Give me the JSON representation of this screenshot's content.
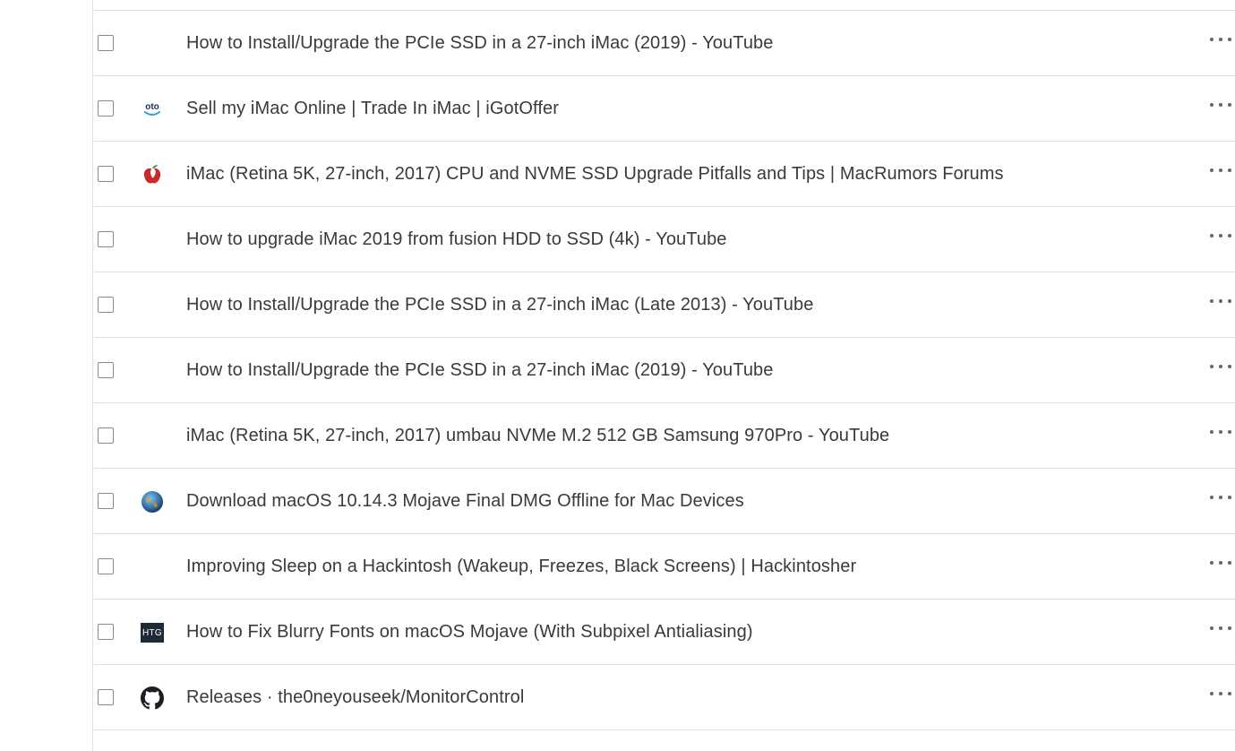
{
  "bookmarks": [
    {
      "title": "How to Install/Upgrade the PCIe SSD in a 27-inch iMac (2019) - YouTube",
      "icon": "none"
    },
    {
      "title": "Sell my iMac Online | Trade In iMac | iGotOffer",
      "icon": "igotoffer-icon"
    },
    {
      "title": "iMac (Retina 5K, 27-inch, 2017) CPU and NVME SSD Upgrade Pitfalls and Tips | MacRumors Forums",
      "icon": "macrumors-apple-icon"
    },
    {
      "title": "How to upgrade iMac 2019 from fusion HDD to SSD (4k) - YouTube",
      "icon": "none"
    },
    {
      "title": "How to Install/Upgrade the PCIe SSD in a 27-inch iMac (Late 2013) - YouTube",
      "icon": "none"
    },
    {
      "title": "How to Install/Upgrade the PCIe SSD in a 27-inch iMac (2019) - YouTube",
      "icon": "none"
    },
    {
      "title": "iMac (Retina 5K, 27-inch, 2017) umbau NVMe M.2 512 GB Samsung 970Pro - YouTube",
      "icon": "none"
    },
    {
      "title": "Download macOS 10.14.3 Mojave Final DMG Offline for Mac Devices",
      "icon": "mojave-globe-icon"
    },
    {
      "title": "Improving Sleep on a Hackintosh (Wakeup, Freezes, Black Screens) | Hackintosher",
      "icon": "none"
    },
    {
      "title": "How to Fix Blurry Fonts on macOS Mojave (With Subpixel Antialiasing)",
      "icon": "htg-icon"
    },
    {
      "title": "Releases · the0neyouseek/MonitorControl",
      "icon": "github-icon"
    }
  ],
  "icons": {
    "igotoffer_text": "oto",
    "htg_text": "HTG"
  },
  "colors": {
    "divider": "#e0e0e0",
    "title_text": "#3a3a3a",
    "igotoffer": "#1a2b5c",
    "igotoffer_smile": "#2aa0e0",
    "macrumors_red": "#cc2a2a",
    "macrumors_green": "#3aa040",
    "github": "#1b1f23",
    "htg_bg": "#1f2a38"
  }
}
